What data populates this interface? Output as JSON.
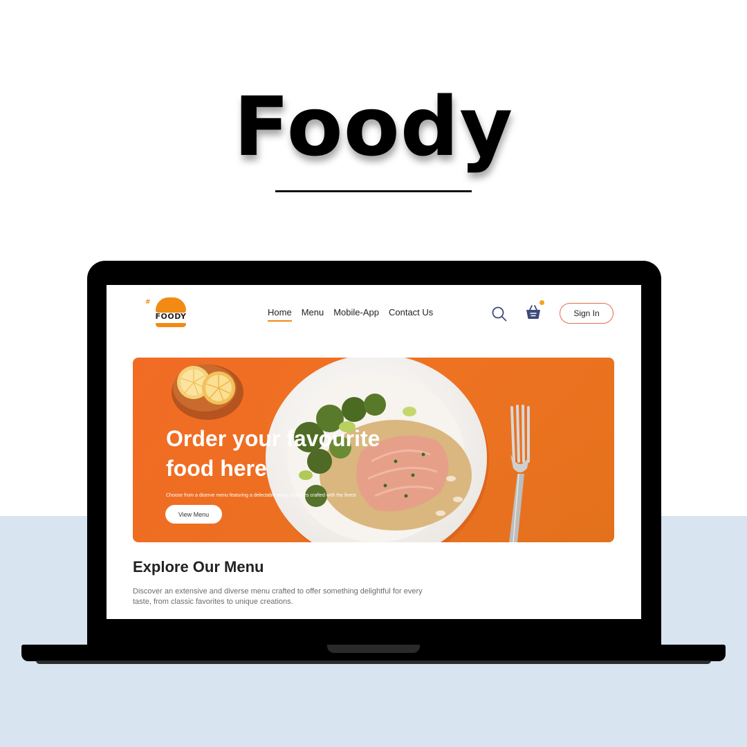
{
  "hero": {
    "title": "Foody"
  },
  "site": {
    "logo_text": "FOODY",
    "logo_tag": "#",
    "nav": [
      {
        "label": "Home",
        "active": true
      },
      {
        "label": "Menu",
        "active": false
      },
      {
        "label": "Mobile-App",
        "active": false
      },
      {
        "label": "Contact Us",
        "active": false
      }
    ],
    "sign_in_label": "Sign In"
  },
  "banner": {
    "title": "Order your favourite food here",
    "subtitle": "Choose from a diserve menu featuring a delectable array of dishes crafted with the finest",
    "button_label": "View Menu"
  },
  "explore": {
    "title": "Explore Our Menu",
    "description": "Discover an extensive and diverse menu crafted to offer something delightful for every taste, from classic favorites to unique creations."
  },
  "colors": {
    "accent": "#f28a14",
    "banner_orange": "#ee7322",
    "signin_border": "#e46b45",
    "basket": "#3d4a7a",
    "bottom_band": "#d8e5f0"
  },
  "icons": {
    "search": "search-icon",
    "basket": "basket-icon",
    "logo": "burger-logo-icon"
  }
}
